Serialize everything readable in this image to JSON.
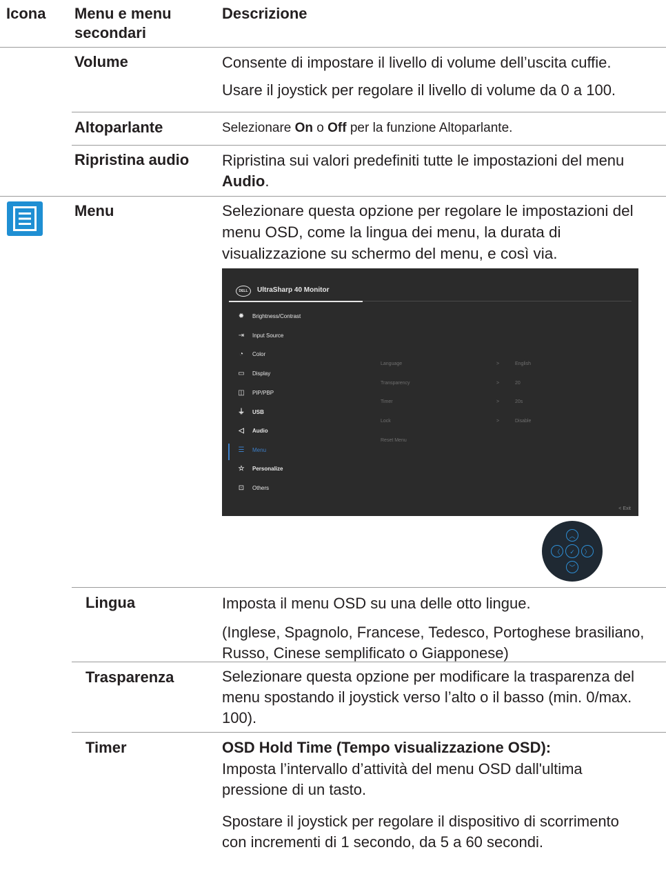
{
  "header": {
    "col_icon": "Icona",
    "col_menu": "Menu e menu secondari",
    "col_desc": "Descrizione"
  },
  "rows": {
    "volume": {
      "label": "Volume",
      "desc1": "Consente di impostare il livello di volume dell’uscita cuffie.",
      "desc2": "Usare il joystick per regolare il livello di volume da 0 a 100."
    },
    "altoparlante": {
      "label": "Altoparlante",
      "desc_pre": "Selezionare ",
      "desc_on": "On",
      "desc_mid": " o ",
      "desc_off": "Off",
      "desc_post": " per la funzione Altoparlante."
    },
    "ripristina": {
      "label": "Ripristina audio",
      "desc_pre": "Ripristina sui valori predefiniti tutte le impostazioni del menu ",
      "desc_bold": "Audio",
      "desc_post": "."
    },
    "menu": {
      "label": "Menu",
      "icon": "menu-icon",
      "desc": "Selezionare questa opzione per regolare le impostazioni del menu OSD, come la lingua dei menu, la durata di visualizzazione su schermo del menu, e così via."
    },
    "lingua": {
      "label": "Lingua",
      "desc1": "Imposta il menu OSD su una delle otto lingue.",
      "desc2": "(Inglese, Spagnolo, Francese, Tedesco, Portoghese brasiliano, Russo, Cinese semplificato o Giapponese)"
    },
    "trasparenza": {
      "label": "Trasparenza",
      "desc": "Selezionare questa opzione per modificare la trasparenza del menu spostando il joystick verso l’alto o il basso (min. 0/max. 100)."
    },
    "timer": {
      "label": "Timer",
      "desc_bold": "OSD Hold Time (Tempo visualizzazione OSD):",
      "desc1": "Imposta l’intervallo d’attività del menu OSD dall'ultima pressione di un tasto.",
      "desc2": "Spostare il joystick per regolare il dispositivo di scorrimento con incrementi di 1 secondo, da 5 a 60 secondi."
    }
  },
  "osd": {
    "logo": "DELL",
    "title": "UltraSharp 40 Monitor",
    "menu_items": [
      {
        "label": "Brightness/Contrast",
        "icon": "brightness-icon"
      },
      {
        "label": "Input Source",
        "icon": "input-source-icon"
      },
      {
        "label": "Color",
        "icon": "color-icon"
      },
      {
        "label": "Display",
        "icon": "display-icon"
      },
      {
        "label": "PIP/PBP",
        "icon": "pip-pbp-icon"
      },
      {
        "label": "USB",
        "icon": "usb-icon"
      },
      {
        "label": "Audio",
        "icon": "audio-icon"
      },
      {
        "label": "Menu",
        "icon": "menu-icon"
      },
      {
        "label": "Personalize",
        "icon": "star-icon"
      },
      {
        "label": "Others",
        "icon": "others-icon"
      }
    ],
    "submenu": [
      {
        "label": "Language",
        "chevron": ">",
        "value": "English"
      },
      {
        "label": "Transparency",
        "chevron": ">",
        "value": "20"
      },
      {
        "label": "Timer",
        "chevron": ">",
        "value": "20s"
      },
      {
        "label": "Lock",
        "chevron": ">",
        "value": "Disable"
      },
      {
        "label": "Reset Menu",
        "chevron": "",
        "value": ""
      }
    ],
    "exit": "<  Exit",
    "accent": "#3d7fc9"
  },
  "joystick": {
    "up": "︿",
    "down": "﹀",
    "left": "〈",
    "right": "〉",
    "center": "✓",
    "accent": "#2e8fd6"
  }
}
